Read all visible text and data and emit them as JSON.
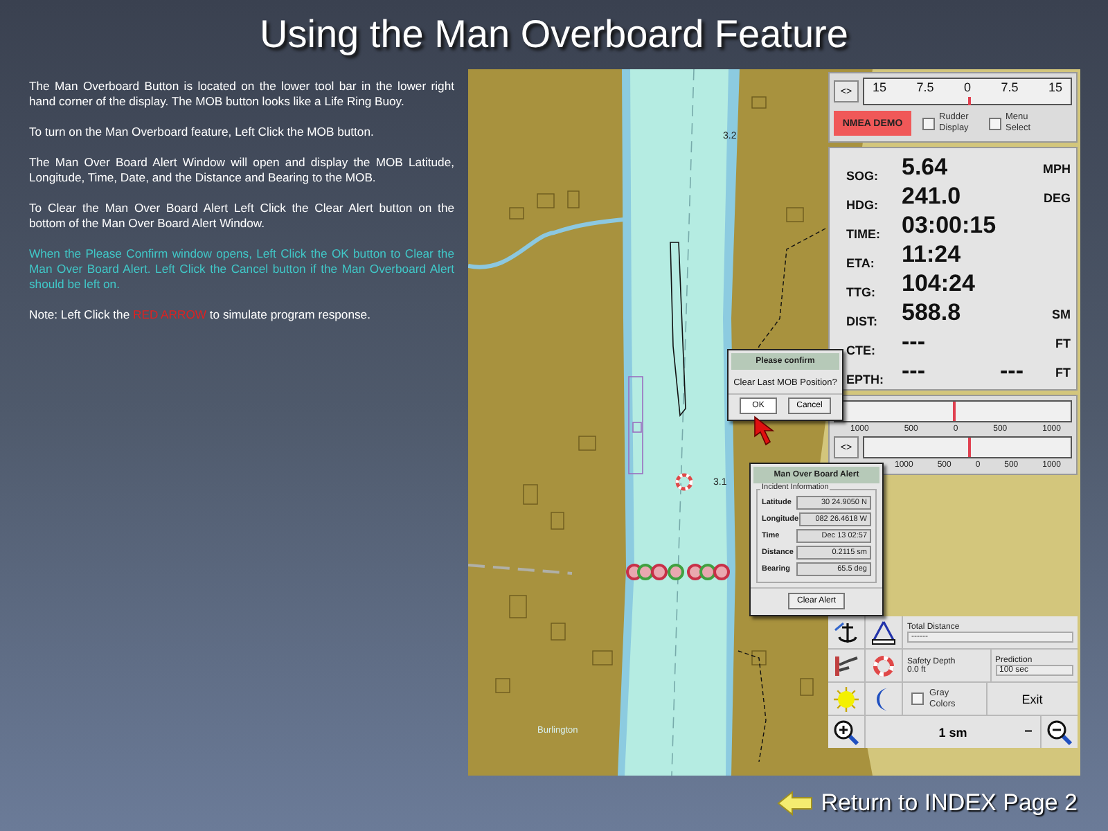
{
  "title": "Using the Man Overboard Feature",
  "instructions": [
    {
      "kind": "normal",
      "text": "The Man Overboard Button is located on the lower tool bar in the lower right hand corner of the display.   The MOB button looks like a Life Ring Buoy."
    },
    {
      "kind": "normal",
      "text": "To turn on the Man Overboard feature, Left Click the MOB button."
    },
    {
      "kind": "normal",
      "text": "The Man Over Board Alert Window will open and display the MOB Latitude, Longitude, Time, Date, and the Distance and Bearing to the MOB."
    },
    {
      "kind": "normal",
      "text": "To Clear the Man Over Board  Alert Left Click the Clear Alert button on the bottom of the Man Over Board Alert Window."
    },
    {
      "kind": "highlight",
      "text": "When the Please Confirm window opens, Left Click the OK button to Clear the Man Over Board Alert.  Left Click the Cancel button if the Man Overboard Alert should be left on."
    }
  ],
  "note": {
    "before": "Note:  Left Click the ",
    "emphasis": "RED ARROW",
    "after": " to simulate program response."
  },
  "map": {
    "labels": [
      "3.2",
      "3.1",
      "Burlington"
    ]
  },
  "instrument_panel": {
    "rudder_scale": {
      "button": "<>",
      "ticks": [
        "15",
        "7.5",
        "0",
        "7.5",
        "15"
      ]
    },
    "nmea_button": "NMEA DEMO",
    "options": [
      {
        "label": "Rudder Display",
        "checked": false
      },
      {
        "label": "Menu Select",
        "checked": false
      }
    ],
    "readings": [
      {
        "label": "SOG:",
        "values": [
          "5.64"
        ],
        "unit": "MPH"
      },
      {
        "label": "HDG:",
        "values": [
          "241.0"
        ],
        "unit": "DEG"
      },
      {
        "label": "TIME:",
        "values": [
          "03:00:15"
        ]
      },
      {
        "label": "ETA:",
        "values": [
          "11:24"
        ]
      },
      {
        "label": "TTG:",
        "values": [
          "104:24"
        ]
      },
      {
        "label": "DIST:",
        "values": [
          "588.8"
        ],
        "unit": "SM"
      },
      {
        "label": "CTE:",
        "values": [
          "---"
        ],
        "unit": "FT"
      },
      {
        "label": "EPTH:",
        "values": [
          "---",
          "---"
        ],
        "unit": "FT"
      }
    ],
    "range_scales": [
      {
        "ticks": [
          "1000",
          "500",
          "0",
          "500",
          "1000"
        ]
      },
      {
        "button": "<>",
        "ticks": [
          "1000",
          "500",
          "0",
          "500",
          "1000"
        ]
      }
    ]
  },
  "toolbar": {
    "total_distance": {
      "label": "Total Distance",
      "value": "------"
    },
    "safety_depth": {
      "label": "Safety Depth",
      "value": "0.0 ft"
    },
    "prediction": {
      "label": "Prediction",
      "value": "100 sec"
    },
    "gray_colors": {
      "label": "Gray Colors",
      "checked": false
    },
    "exit_button": "Exit",
    "range_select": "1 sm"
  },
  "confirm_dialog": {
    "title": "Please confirm",
    "message": "Clear Last MOB Position?",
    "buttons": [
      "OK",
      "Cancel"
    ]
  },
  "alert_dialog": {
    "title": "Man Over Board Alert",
    "group": "Incident Information",
    "fields": [
      {
        "label": "Latitude",
        "value": "30 24.9050 N"
      },
      {
        "label": "Longitude",
        "value": "082 26.4618 W"
      },
      {
        "label": "Time",
        "value": "Dec 13  02:57"
      },
      {
        "label": "Distance",
        "value": "0.2115 sm"
      },
      {
        "label": "Bearing",
        "value": "65.5 deg"
      }
    ],
    "button": "Clear Alert"
  },
  "footer_link": "Return to INDEX Page 2"
}
